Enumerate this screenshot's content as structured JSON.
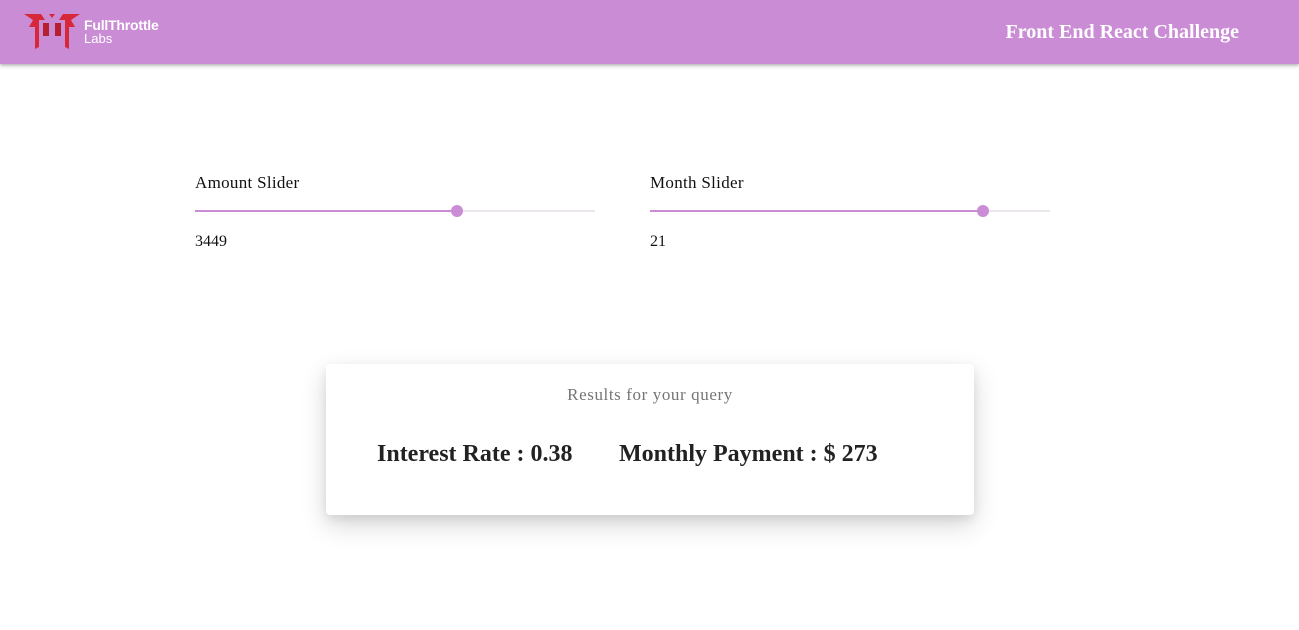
{
  "appbar": {
    "logo": {
      "name": "FullThrottle",
      "sub": "Labs"
    },
    "title": "Front End React Challenge",
    "colors": {
      "background": "#cb8cd6",
      "logo_mark": "#d62839"
    }
  },
  "sliders": [
    {
      "label": "Amount Slider",
      "value": "3449",
      "fill_fraction": 0.655
    },
    {
      "label": "Month Slider",
      "value": "21",
      "fill_fraction": 0.833
    }
  ],
  "results": {
    "heading": "Results for your query",
    "interest_rate": "Interest Rate : 0.38",
    "monthly_payment": "Monthly Payment : $ 273"
  }
}
